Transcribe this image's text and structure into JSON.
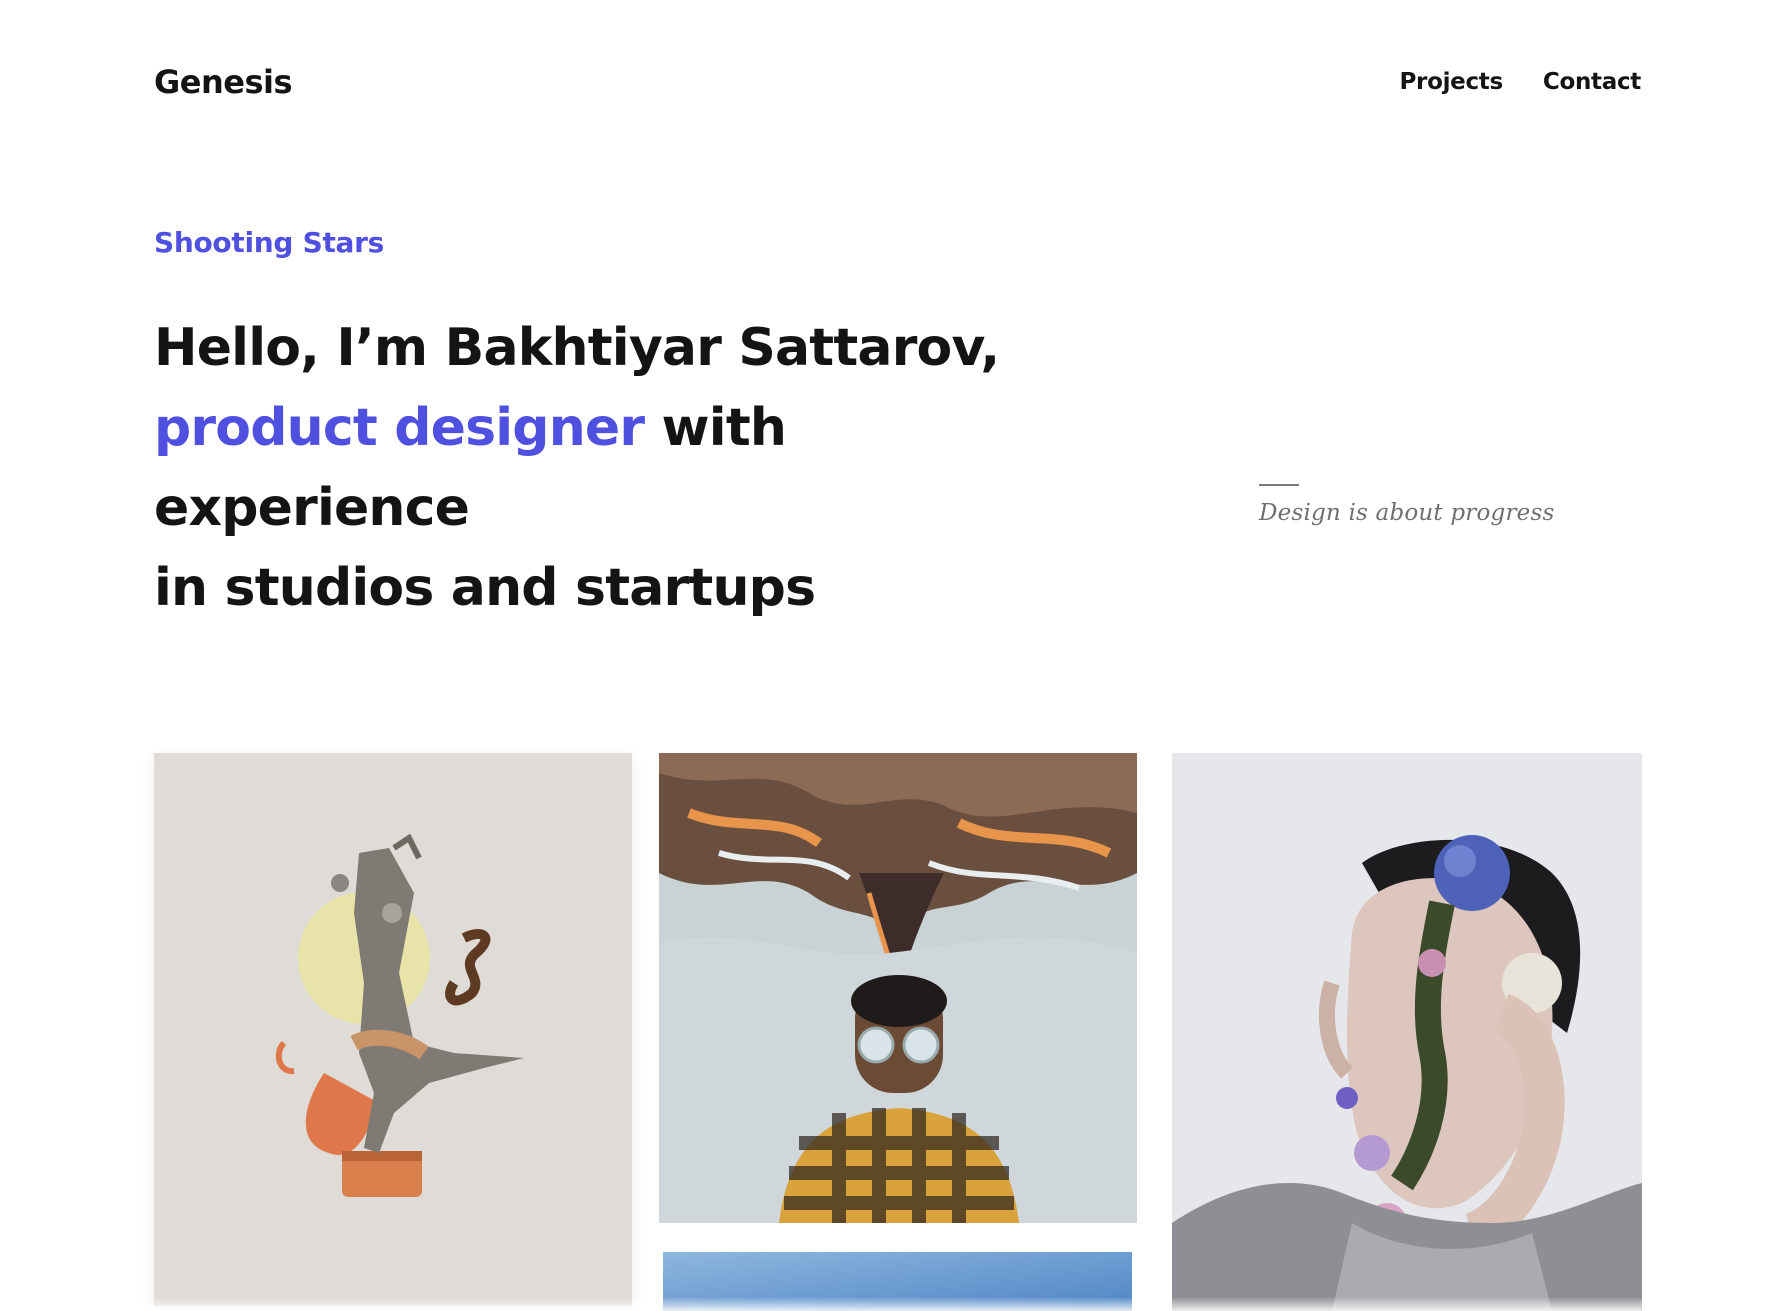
{
  "header": {
    "brand": "Genesis",
    "nav": [
      {
        "label": "Projects"
      },
      {
        "label": "Contact"
      }
    ]
  },
  "hero": {
    "eyebrow": "Shooting Stars",
    "line1": "Hello, I’m Bakhtiyar Sattarov,",
    "accent": "product designer",
    "line2_rest": " with experience",
    "line3": "in studios and startups"
  },
  "tagline": "Design is about progress",
  "colors": {
    "accent": "#4f4fe0",
    "text": "#141414",
    "muted": "#6f6f6f"
  },
  "gallery": {
    "tiles": [
      {
        "subject": "collage of a dancer on a music box"
      },
      {
        "subject": "man in sunglasses with swirling landscape above his head"
      },
      {
        "subject": "portrait of a man with flowers over his face"
      },
      {
        "subject": "blue sky"
      }
    ]
  }
}
